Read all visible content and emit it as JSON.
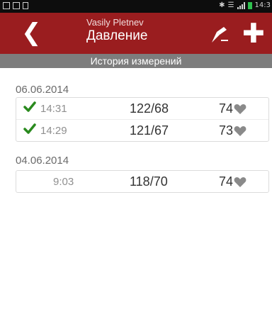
{
  "status_bar": {
    "time": "14:3"
  },
  "app_bar": {
    "account_name": "Vasily Pletnev",
    "screen_title": "Давление",
    "back_icon": "chevron-left-icon",
    "edit_icon": "edit-icon",
    "add_icon": "plus-icon"
  },
  "section_title": "История измерений",
  "colors": {
    "appbar": "#9a1d1f",
    "subheader": "#7d7d7d",
    "check": "#2a8a1e",
    "heart": "#8a8a8a"
  },
  "groups": [
    {
      "date": "06.06.2014",
      "entries": [
        {
          "time": "14:31",
          "pressure": "122/68",
          "pulse": "74",
          "checked": true
        },
        {
          "time": "14:29",
          "pressure": "121/67",
          "pulse": "73",
          "checked": true
        }
      ]
    },
    {
      "date": "04.06.2014",
      "entries": [
        {
          "time": "9:03",
          "pressure": "118/70",
          "pulse": "74",
          "checked": false
        }
      ]
    }
  ]
}
